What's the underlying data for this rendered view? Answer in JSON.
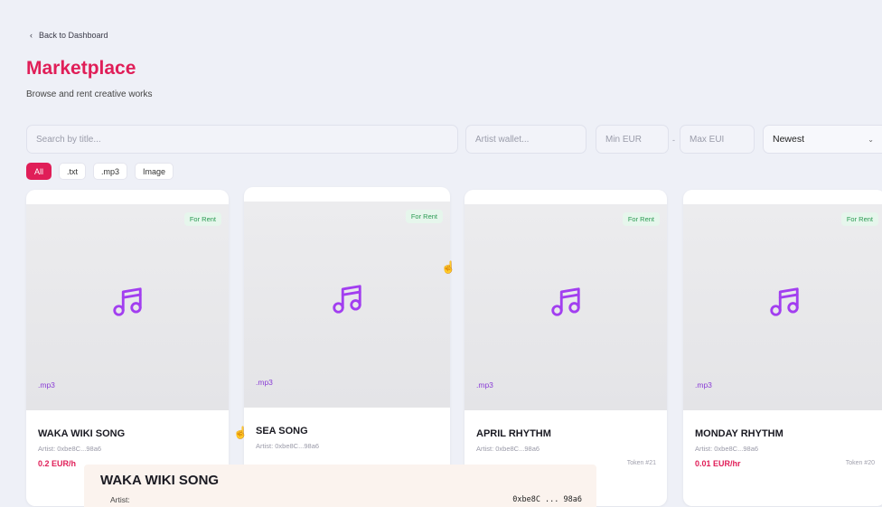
{
  "nav": {
    "back_label": "Back to Dashboard"
  },
  "header": {
    "title": "Marketplace",
    "subtitle": "Browse and rent creative works"
  },
  "filters": {
    "search_placeholder": "Search by title...",
    "wallet_placeholder": "Artist wallet...",
    "min_placeholder": "Min EUR",
    "separator": "-",
    "max_placeholder": "Max EUI",
    "sort_value": "Newest"
  },
  "chips": [
    {
      "label": "All",
      "active": true
    },
    {
      "label": ".txt",
      "active": false
    },
    {
      "label": ".mp3",
      "active": false
    },
    {
      "label": "Image",
      "active": false
    }
  ],
  "cards": [
    {
      "badge": "For Rent",
      "ext": ".mp3",
      "name": "WAKA WIKI SONG",
      "artist": "Artist: 0xbe8C...98a6",
      "price": "0.2 EUR/h",
      "token": ""
    },
    {
      "badge": "For Rent",
      "ext": ".mp3",
      "name": "SEA SONG",
      "artist": "Artist: 0xbe8C...98a6",
      "price": "",
      "token": ""
    },
    {
      "badge": "For Rent",
      "ext": ".mp3",
      "name": "APRIL RHYTHM",
      "artist": "Artist: 0xbe8C...98a6",
      "price": "",
      "token": "Token #21"
    },
    {
      "badge": "For Rent",
      "ext": ".mp3",
      "name": "MONDAY RHYTHM",
      "artist": "Artist: 0xbe8C...98a6",
      "price": "0.01 EUR/hr",
      "token": "Token #20"
    }
  ],
  "tooltip": {
    "title": "WAKA WIKI SONG",
    "label": "Artist:",
    "value": "0xbe8C ... 98a6"
  },
  "colors": {
    "accent": "#e01e58",
    "icon": "#a23ef0",
    "rent_badge": "#2a9a52"
  },
  "icons": {
    "card_icon": "music-note-icon",
    "back_icon": "chevron-left-icon",
    "sort_icon": "chevron-down-icon"
  }
}
